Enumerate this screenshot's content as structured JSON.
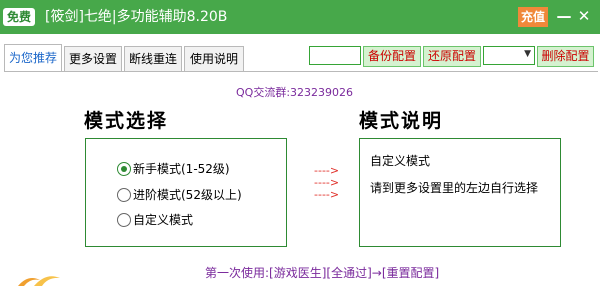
{
  "titlebar": {
    "badge": "免费",
    "title": "[筱剑]七绝|多功能辅助8.20B",
    "recharge": "充值",
    "minimize": "—",
    "close": "✕"
  },
  "tabs": [
    {
      "label": "为您推荐",
      "active": true
    },
    {
      "label": "更多设置"
    },
    {
      "label": "断线重连"
    },
    {
      "label": "使用说明"
    }
  ],
  "toolbar": {
    "backup": "备份配置",
    "restore": "还原配置",
    "delete": "删除配置",
    "select_value": ""
  },
  "qq_group": "QQ交流群:323239026",
  "mode": {
    "heading": "模式选择",
    "options": [
      {
        "label": "新手模式(1-52级)",
        "selected": true
      },
      {
        "label": "进阶模式(52级以上)",
        "selected": false
      },
      {
        "label": "自定义模式",
        "selected": false
      }
    ]
  },
  "arrows": "---->",
  "description": {
    "heading": "模式说明",
    "lines": [
      "自定义模式",
      "请到更多设置里的左边自行选择"
    ]
  },
  "footer": "第一次使用:[游戏医生][全通过]→[重置配置]",
  "colors": {
    "title_bar": "#47a84a",
    "accent_green": "#2e8a33",
    "recharge": "#f0883a",
    "purple_text": "#7a2a9c",
    "red_text": "#cc0000"
  }
}
